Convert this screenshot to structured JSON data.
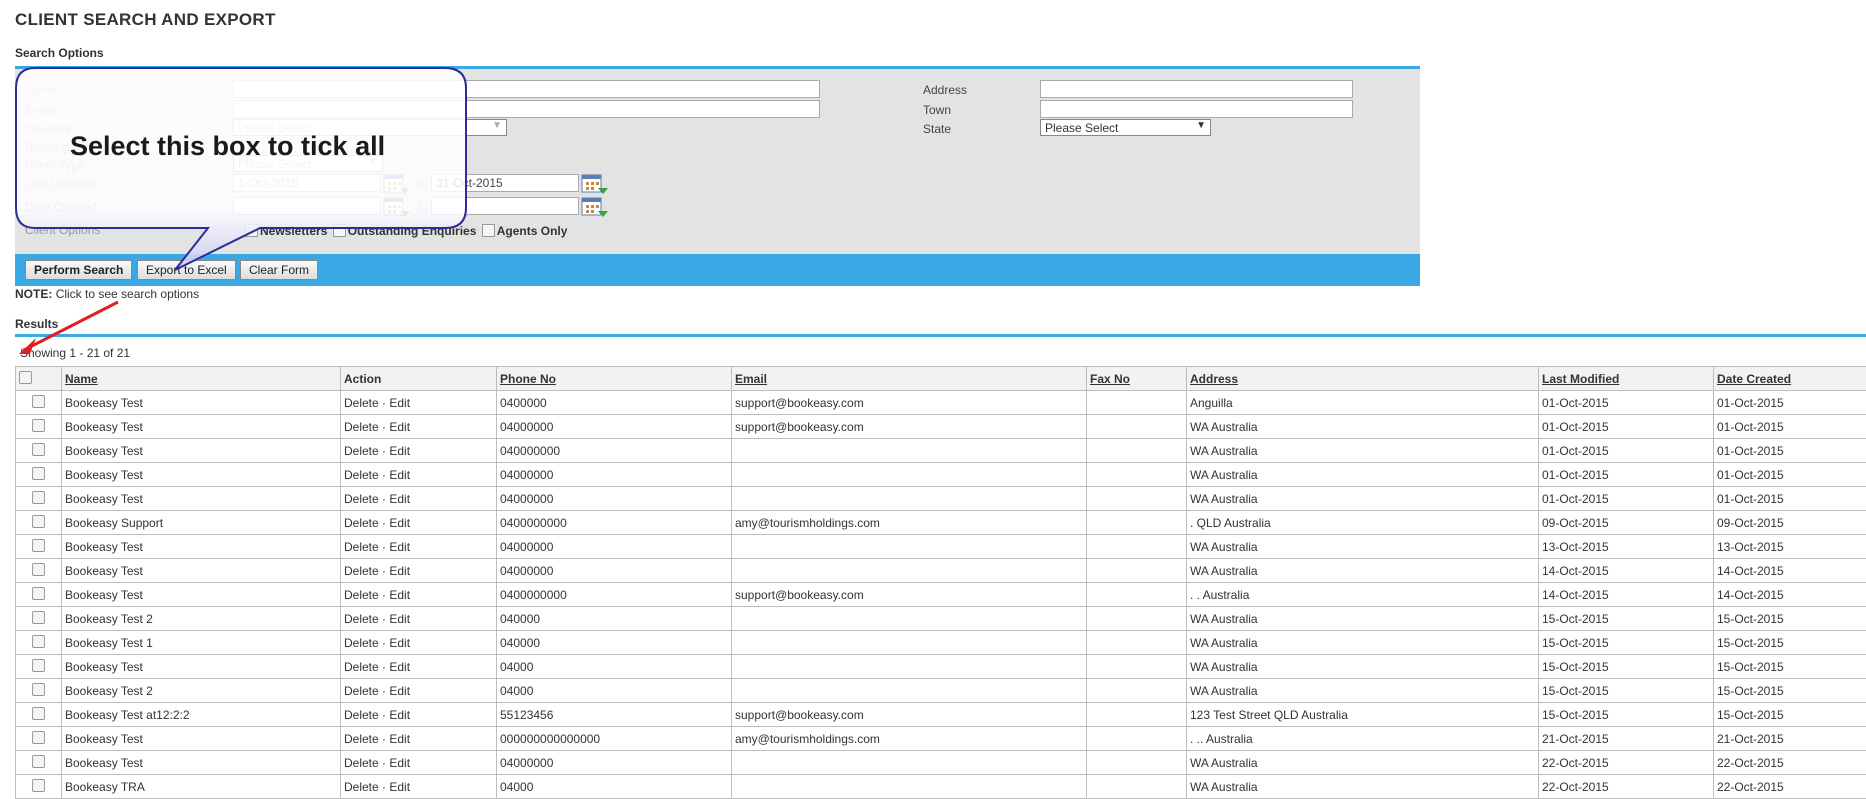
{
  "page": {
    "title": "CLIENT SEARCH AND EXPORT",
    "search_options_label": "Search Options",
    "results_label": "Results"
  },
  "search": {
    "name_label": "Name",
    "email_label": "Email",
    "operator_label": "Operator",
    "booking_label": "Booking",
    "client_type_label": "Client Type",
    "last_updated_label": "Last Updated",
    "date_created_label": "Date Created",
    "client_options_label": "Client Options",
    "address_label": "Address",
    "town_label": "Town",
    "state_label": "State",
    "operator_select": "Please Select",
    "client_type_select": "Please Select",
    "state_select": "Please Select",
    "last_updated_from": "1-Oct-2015",
    "last_updated_to": "31-Oct-2015",
    "date_created_from": "",
    "date_created_to": "",
    "to_label": "To",
    "opt_newsletters": "Newsletters",
    "opt_enquiries": "Outstanding Enquiries",
    "opt_agents": "Agents Only"
  },
  "buttons": {
    "perform_search": "Perform Search",
    "export_excel": "Export to Excel",
    "clear_form": "Clear Form"
  },
  "note": {
    "prefix": "NOTE:",
    "text": "Click to see search options"
  },
  "results": {
    "showing": "Showing 1 - 21 of 21",
    "columns": [
      "Name",
      "Action",
      "Phone No",
      "Email",
      "Fax No",
      "Address",
      "Last Modified",
      "Date Created"
    ],
    "action_delete": "Delete",
    "action_sep": "·",
    "action_edit": "Edit",
    "rows": [
      {
        "name": "Bookeasy Test",
        "phone": "0400000",
        "email": "support@bookeasy.com",
        "fax": "",
        "address": "Anguilla",
        "modified": "01-Oct-2015",
        "created": "01-Oct-2015"
      },
      {
        "name": "Bookeasy Test",
        "phone": "04000000",
        "email": "support@bookeasy.com",
        "fax": "",
        "address": "WA Australia",
        "modified": "01-Oct-2015",
        "created": "01-Oct-2015"
      },
      {
        "name": "Bookeasy Test",
        "phone": "040000000",
        "email": "",
        "fax": "",
        "address": "WA Australia",
        "modified": "01-Oct-2015",
        "created": "01-Oct-2015"
      },
      {
        "name": "Bookeasy Test",
        "phone": "04000000",
        "email": "",
        "fax": "",
        "address": "WA Australia",
        "modified": "01-Oct-2015",
        "created": "01-Oct-2015"
      },
      {
        "name": "Bookeasy Test",
        "phone": "04000000",
        "email": "",
        "fax": "",
        "address": "WA Australia",
        "modified": "01-Oct-2015",
        "created": "01-Oct-2015"
      },
      {
        "name": "Bookeasy Support",
        "phone": "0400000000",
        "email": "amy@tourismholdings.com",
        "fax": "",
        "address": ". QLD Australia",
        "modified": "09-Oct-2015",
        "created": "09-Oct-2015"
      },
      {
        "name": "Bookeasy Test",
        "phone": "04000000",
        "email": "",
        "fax": "",
        "address": "WA Australia",
        "modified": "13-Oct-2015",
        "created": "13-Oct-2015"
      },
      {
        "name": "Bookeasy Test",
        "phone": "04000000",
        "email": "",
        "fax": "",
        "address": "WA Australia",
        "modified": "14-Oct-2015",
        "created": "14-Oct-2015"
      },
      {
        "name": "Bookeasy Test",
        "phone": "0400000000",
        "email": "support@bookeasy.com",
        "fax": "",
        "address": ". . Australia",
        "modified": "14-Oct-2015",
        "created": "14-Oct-2015"
      },
      {
        "name": "Bookeasy Test 2",
        "phone": "040000",
        "email": "",
        "fax": "",
        "address": "WA Australia",
        "modified": "15-Oct-2015",
        "created": "15-Oct-2015"
      },
      {
        "name": "Bookeasy Test 1",
        "phone": "040000",
        "email": "",
        "fax": "",
        "address": "WA Australia",
        "modified": "15-Oct-2015",
        "created": "15-Oct-2015"
      },
      {
        "name": "Bookeasy Test",
        "phone": "04000",
        "email": "",
        "fax": "",
        "address": "WA Australia",
        "modified": "15-Oct-2015",
        "created": "15-Oct-2015"
      },
      {
        "name": "Bookeasy Test 2",
        "phone": "04000",
        "email": "",
        "fax": "",
        "address": "WA Australia",
        "modified": "15-Oct-2015",
        "created": "15-Oct-2015"
      },
      {
        "name": "Bookeasy Test at12:2:2",
        "phone": "55123456",
        "email": "support@bookeasy.com",
        "fax": "",
        "address": "123 Test Street QLD Australia",
        "modified": "15-Oct-2015",
        "created": "15-Oct-2015"
      },
      {
        "name": "Bookeasy Test",
        "phone": "000000000000000",
        "email": "amy@tourismholdings.com",
        "fax": "",
        "address": ". .. Australia",
        "modified": "21-Oct-2015",
        "created": "21-Oct-2015"
      },
      {
        "name": "Bookeasy Test",
        "phone": "04000000",
        "email": "",
        "fax": "",
        "address": "WA Australia",
        "modified": "22-Oct-2015",
        "created": "22-Oct-2015"
      },
      {
        "name": "Bookeasy TRA",
        "phone": "04000",
        "email": "",
        "fax": "",
        "address": "WA Australia",
        "modified": "22-Oct-2015",
        "created": "22-Oct-2015"
      }
    ]
  },
  "callout": {
    "text": "Select this box to tick all",
    "arrow_color": "#e02020",
    "bubble_border": "#2b2b9a"
  },
  "colors": {
    "accent": "#3aa8e4",
    "panel": "#e3e3e3"
  },
  "icons": [
    "calendar-icon",
    "dropdown-arrow-icon",
    "checkbox-icon"
  ]
}
